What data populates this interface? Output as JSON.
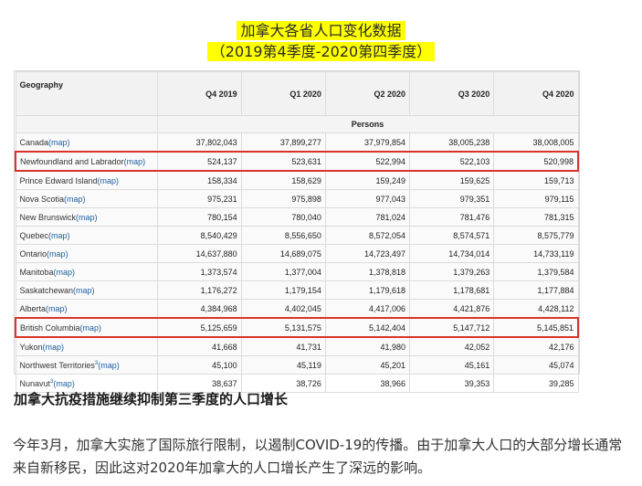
{
  "title": {
    "line1": "加拿大各省人口变化数据",
    "line2": "（2019第4季度-2020第四季度）"
  },
  "table": {
    "geo_header": "Geography",
    "columns": [
      "Q4 2019",
      "Q1 2020",
      "Q2 2020",
      "Q3 2020",
      "Q4 2020"
    ],
    "units": "Persons",
    "rows": [
      {
        "name": "Canada",
        "link": "(map)",
        "sup": "",
        "values": [
          "37,802,043",
          "37,899,277",
          "37,979,854",
          "38,005,238",
          "38,008,005"
        ],
        "highlight": false
      },
      {
        "name": "Newfoundland and Labrador",
        "link": "(map)",
        "sup": "",
        "values": [
          "524,137",
          "523,631",
          "522,994",
          "522,103",
          "520,998"
        ],
        "highlight": true
      },
      {
        "name": "Prince Edward Island",
        "link": "(map)",
        "sup": "",
        "values": [
          "158,334",
          "158,629",
          "159,249",
          "159,625",
          "159,713"
        ],
        "highlight": false
      },
      {
        "name": "Nova Scotia",
        "link": "(map)",
        "sup": "",
        "values": [
          "975,231",
          "975,898",
          "977,043",
          "979,351",
          "979,115"
        ],
        "highlight": false
      },
      {
        "name": "New Brunswick",
        "link": "(map)",
        "sup": "",
        "values": [
          "780,154",
          "780,040",
          "781,024",
          "781,476",
          "781,315"
        ],
        "highlight": false
      },
      {
        "name": "Quebec",
        "link": "(map)",
        "sup": "",
        "values": [
          "8,540,429",
          "8,556,650",
          "8,572,054",
          "8,574,571",
          "8,575,779"
        ],
        "highlight": false
      },
      {
        "name": "Ontario",
        "link": "(map)",
        "sup": "",
        "values": [
          "14,637,880",
          "14,689,075",
          "14,723,497",
          "14,734,014",
          "14,733,119"
        ],
        "highlight": false
      },
      {
        "name": "Manitoba",
        "link": "(map)",
        "sup": "",
        "values": [
          "1,373,574",
          "1,377,004",
          "1,378,818",
          "1,379,263",
          "1,379,584"
        ],
        "highlight": false
      },
      {
        "name": "Saskatchewan",
        "link": "(map)",
        "sup": "",
        "values": [
          "1,176,272",
          "1,179,154",
          "1,179,618",
          "1,178,681",
          "1,177,884"
        ],
        "highlight": false
      },
      {
        "name": "Alberta",
        "link": "(map)",
        "sup": "",
        "values": [
          "4,384,968",
          "4,402,045",
          "4,417,006",
          "4,421,876",
          "4,428,112"
        ],
        "highlight": false
      },
      {
        "name": "British Columbia",
        "link": "(map)",
        "sup": "",
        "values": [
          "5,125,659",
          "5,131,575",
          "5,142,404",
          "5,147,712",
          "5,145,851"
        ],
        "highlight": true
      },
      {
        "name": "Yukon",
        "link": "(map)",
        "sup": "",
        "values": [
          "41,668",
          "41,731",
          "41,980",
          "42,052",
          "42,176"
        ],
        "highlight": false
      },
      {
        "name": "Northwest Territories",
        "link": "(map)",
        "sup": "3",
        "values": [
          "45,100",
          "45,119",
          "45,201",
          "45,161",
          "45,074"
        ],
        "highlight": false
      },
      {
        "name": "Nunavut",
        "link": "(map)",
        "sup": "3",
        "values": [
          "38,637",
          "38,726",
          "38,966",
          "39,353",
          "39,285"
        ],
        "highlight": false
      }
    ],
    "highlight_color": "#d9342b"
  },
  "heading": "加拿大抗疫措施继续抑制第三季度的人口增长",
  "paragraph": "今年3月，加拿大实施了国际旅行限制，以遏制COVID-19的传播。由于加拿大人口的大部分增长通常来自新移民，因此这对2020年加拿大的人口增长产生了深远的影响。"
}
